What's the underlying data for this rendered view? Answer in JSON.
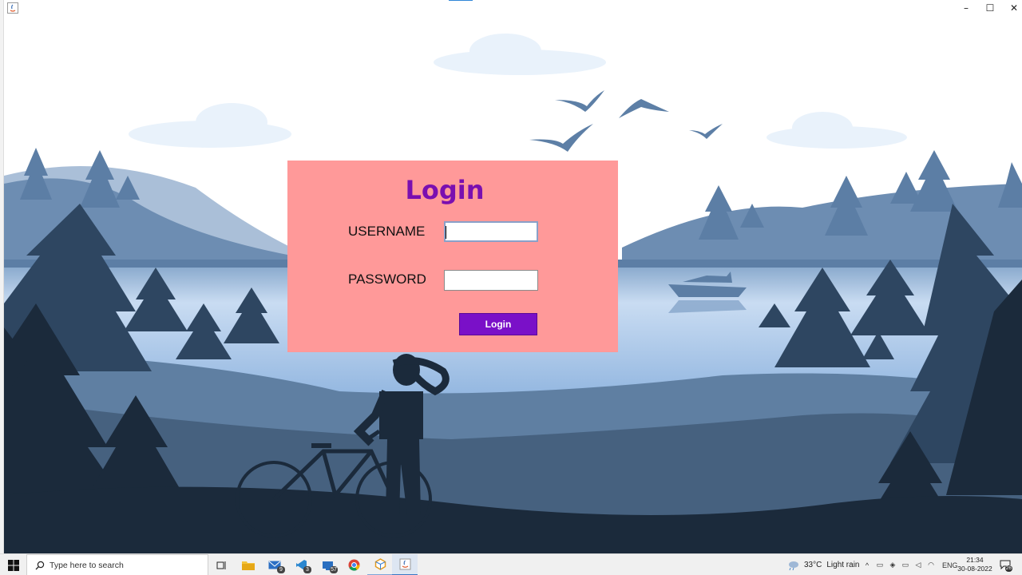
{
  "window": {
    "title": "",
    "controls": {
      "minimize": "–",
      "maximize": "☐",
      "close": "✕"
    }
  },
  "login": {
    "title": "Login",
    "username_label": "USERNAME",
    "username_value": "",
    "password_label": "PASSWORD",
    "password_value": "",
    "button_label": "Login"
  },
  "colors": {
    "panel_bg": "#ff9999",
    "title_color": "#7a0fb0",
    "button_bg": "#7a10c8",
    "sky": "#ffffff",
    "lake": "#b9d3ee"
  },
  "taskbar": {
    "search_placeholder": "Type here to search",
    "apps": [
      {
        "icon": "task-view-icon",
        "badge": ""
      },
      {
        "icon": "file-explorer-icon",
        "badge": ""
      },
      {
        "icon": "mail-icon",
        "badge": "9"
      },
      {
        "icon": "visual-studio-code-icon",
        "badge": "3"
      },
      {
        "icon": "app-icon",
        "badge": "57"
      },
      {
        "icon": "chrome-icon",
        "badge": ""
      },
      {
        "icon": "app-cube-icon",
        "badge": ""
      },
      {
        "icon": "java-icon",
        "badge": ""
      }
    ],
    "weather": {
      "temperature": "33°C",
      "condition": "Light rain"
    },
    "language": "ENG",
    "time": "21:34",
    "date": "30-08-2022",
    "notification_count": "26"
  }
}
